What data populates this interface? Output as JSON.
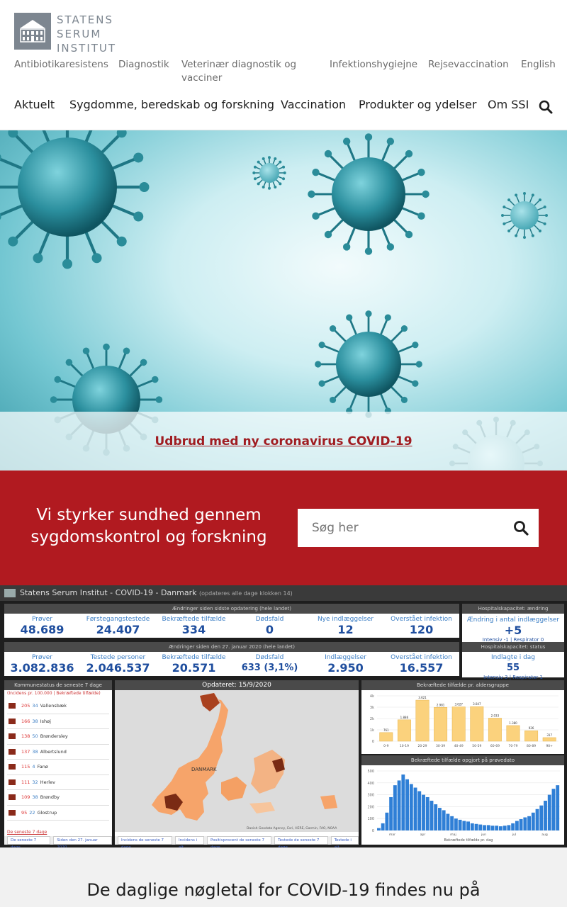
{
  "header": {
    "logo_lines": [
      "STATENS",
      "SERUM",
      "INSTITUT"
    ],
    "toplinks": [
      "Antibiotikaresistens",
      "Diagnostik",
      "Veterinær diagnostik og vacciner",
      "Infektionshygiejne",
      "Rejsevaccination",
      "English"
    ],
    "nav": [
      "Aktuelt",
      "Sygdomme, beredskab og forskning",
      "Vaccination",
      "Produkter og ydelser",
      "Om SSI"
    ]
  },
  "hero": {
    "link_text": "Udbrud med ny coronavirus COVID-19"
  },
  "redband": {
    "tagline": "Vi styrker sundhed gennem sygdomskontrol og forskning",
    "search_placeholder": "Søg her"
  },
  "dashboard": {
    "title": "Statens Serum Institut - COVID-19 - Danmark",
    "title_note": "(opdateres alle dage klokken 14)",
    "row1_head": "Ændringer siden sidste opdatering (hele landet)",
    "row1": [
      {
        "label": "Prøver",
        "value": "48.689"
      },
      {
        "label": "Førstegangstestede",
        "value": "24.407"
      },
      {
        "label": "Bekræftede tilfælde",
        "value": "334"
      },
      {
        "label": "Dødsfald",
        "value": "0"
      },
      {
        "label": "Nye indlæggelser",
        "value": "12"
      },
      {
        "label": "Overstået infektion",
        "value": "120"
      }
    ],
    "row2_head": "Ændringer siden den 27. januar 2020 (hele landet)",
    "row2": [
      {
        "label": "Prøver",
        "value": "3.082.836"
      },
      {
        "label": "Testede personer",
        "value": "2.046.537"
      },
      {
        "label": "Bekræftede tilfælde",
        "value": "20.571"
      },
      {
        "label": "Dødsfald",
        "value": "633 (3,1%)"
      },
      {
        "label": "Indlæggelser",
        "value": "2.950"
      },
      {
        "label": "Overstået infektion",
        "value": "16.557"
      }
    ],
    "hosp1_head": "Hospitalskapacitet: ændring",
    "hosp1_label": "Ændring i antal indlæggelser",
    "hosp1_value": "+5",
    "hosp1_sub": "Intensiv -1 | Respirator 0",
    "hosp2_head": "Hospitalskapacitet: status",
    "hosp2_label": "Indlagte i dag",
    "hosp2_value": "55",
    "hosp2_sub": "Intensiv 3 | Respirator 1",
    "kommune_head": "Kommunestatus de seneste 7 dage",
    "kommune_sub": "(Incidens pr. 100.000 | Bekræftede tilfælde)",
    "kommuner": [
      {
        "inc": "205",
        "cases": "34",
        "name": "Vallensbæk"
      },
      {
        "inc": "166",
        "cases": "38",
        "name": "Ishøj"
      },
      {
        "inc": "138",
        "cases": "50",
        "name": "Brøndersley"
      },
      {
        "inc": "137",
        "cases": "38",
        "name": "Albertslund"
      },
      {
        "inc": "115",
        "cases": "4",
        "name": "Fanø"
      },
      {
        "inc": "111",
        "cases": "32",
        "name": "Herlev"
      },
      {
        "inc": "109",
        "cases": "38",
        "name": "Brøndby"
      },
      {
        "inc": "95",
        "cases": "22",
        "name": "Glostrup"
      }
    ],
    "kommune_link": "De seneste 7 dage",
    "kommune_tabs": [
      "De seneste 7 dage",
      "Siden den 27. januar 2020"
    ],
    "map_head": "Opdateret: 15/9/2020",
    "map_label": "DANMARK",
    "map_credit": "Danish Geodata Agency, Esri, HERE, Garmin, FAO, NOAA",
    "map_tabs": [
      "Incidens de seneste 7 dage",
      "Incidens i alt",
      "Positivprocent de seneste 7 dage",
      "Testede de seneste 7 dage",
      "Testede i alt"
    ],
    "age_head": "Bekræftede tilfælde pr. aldersgruppe",
    "epi_head": "Bekræftede tilfælde opgjort på prøvedato",
    "epi_xlabel": "Bekræftede tilfælde pr. dag"
  },
  "chart_data": [
    {
      "type": "bar",
      "title": "Bekræftede tilfælde pr. aldersgruppe",
      "categories": [
        "0-9",
        "10-19",
        "20-29",
        "30-39",
        "40-49",
        "50-59",
        "60-69",
        "70-79",
        "80-89",
        "90+"
      ],
      "values": [
        761,
        1886,
        3621,
        2981,
        3027,
        3047,
        2033,
        1380,
        926,
        317
      ],
      "ylim": [
        0,
        4000
      ],
      "yticks": [
        "0",
        "1k",
        "2k",
        "3k",
        "4k"
      ],
      "color": "#fbd27d"
    },
    {
      "type": "bar",
      "title": "Bekræftede tilfælde opgjort på prøvedato",
      "xlabel": "Bekræftede tilfælde pr. dag",
      "categories": [
        "mar",
        "apr",
        "maj",
        "jun",
        "jul",
        "aug"
      ],
      "values": [
        20,
        60,
        150,
        280,
        380,
        420,
        470,
        430,
        390,
        360,
        330,
        300,
        280,
        250,
        220,
        190,
        170,
        140,
        120,
        100,
        90,
        80,
        75,
        60,
        55,
        50,
        45,
        45,
        40,
        40,
        35,
        40,
        45,
        60,
        80,
        95,
        110,
        120,
        150,
        180,
        210,
        250,
        300,
        350,
        380
      ],
      "ylim": [
        0,
        500
      ],
      "yticks": [
        "0",
        "100",
        "200",
        "300",
        "400",
        "500"
      ],
      "color": "#2f7fd6"
    }
  ]
}
